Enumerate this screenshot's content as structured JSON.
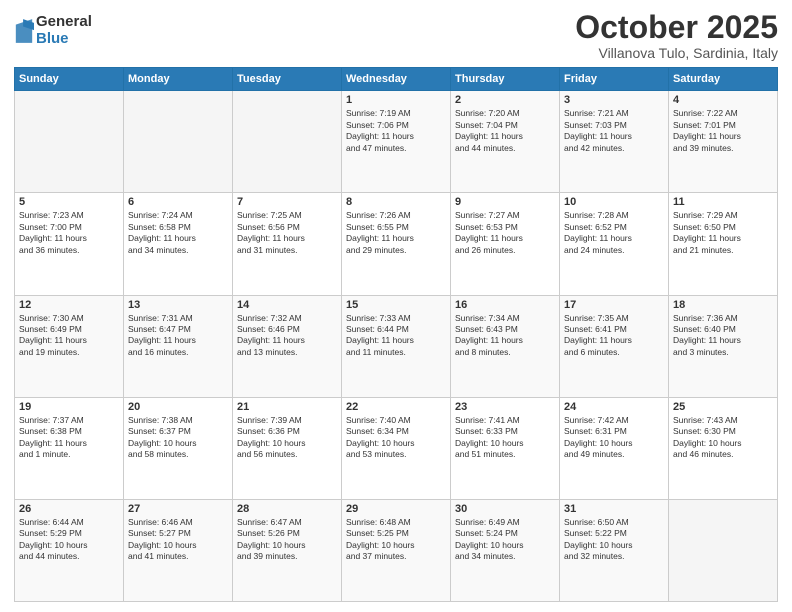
{
  "logo": {
    "general": "General",
    "blue": "Blue"
  },
  "title": "October 2025",
  "subtitle": "Villanova Tulo, Sardinia, Italy",
  "headers": [
    "Sunday",
    "Monday",
    "Tuesday",
    "Wednesday",
    "Thursday",
    "Friday",
    "Saturday"
  ],
  "weeks": [
    [
      {
        "day": "",
        "info": ""
      },
      {
        "day": "",
        "info": ""
      },
      {
        "day": "",
        "info": ""
      },
      {
        "day": "1",
        "info": "Sunrise: 7:19 AM\nSunset: 7:06 PM\nDaylight: 11 hours\nand 47 minutes."
      },
      {
        "day": "2",
        "info": "Sunrise: 7:20 AM\nSunset: 7:04 PM\nDaylight: 11 hours\nand 44 minutes."
      },
      {
        "day": "3",
        "info": "Sunrise: 7:21 AM\nSunset: 7:03 PM\nDaylight: 11 hours\nand 42 minutes."
      },
      {
        "day": "4",
        "info": "Sunrise: 7:22 AM\nSunset: 7:01 PM\nDaylight: 11 hours\nand 39 minutes."
      }
    ],
    [
      {
        "day": "5",
        "info": "Sunrise: 7:23 AM\nSunset: 7:00 PM\nDaylight: 11 hours\nand 36 minutes."
      },
      {
        "day": "6",
        "info": "Sunrise: 7:24 AM\nSunset: 6:58 PM\nDaylight: 11 hours\nand 34 minutes."
      },
      {
        "day": "7",
        "info": "Sunrise: 7:25 AM\nSunset: 6:56 PM\nDaylight: 11 hours\nand 31 minutes."
      },
      {
        "day": "8",
        "info": "Sunrise: 7:26 AM\nSunset: 6:55 PM\nDaylight: 11 hours\nand 29 minutes."
      },
      {
        "day": "9",
        "info": "Sunrise: 7:27 AM\nSunset: 6:53 PM\nDaylight: 11 hours\nand 26 minutes."
      },
      {
        "day": "10",
        "info": "Sunrise: 7:28 AM\nSunset: 6:52 PM\nDaylight: 11 hours\nand 24 minutes."
      },
      {
        "day": "11",
        "info": "Sunrise: 7:29 AM\nSunset: 6:50 PM\nDaylight: 11 hours\nand 21 minutes."
      }
    ],
    [
      {
        "day": "12",
        "info": "Sunrise: 7:30 AM\nSunset: 6:49 PM\nDaylight: 11 hours\nand 19 minutes."
      },
      {
        "day": "13",
        "info": "Sunrise: 7:31 AM\nSunset: 6:47 PM\nDaylight: 11 hours\nand 16 minutes."
      },
      {
        "day": "14",
        "info": "Sunrise: 7:32 AM\nSunset: 6:46 PM\nDaylight: 11 hours\nand 13 minutes."
      },
      {
        "day": "15",
        "info": "Sunrise: 7:33 AM\nSunset: 6:44 PM\nDaylight: 11 hours\nand 11 minutes."
      },
      {
        "day": "16",
        "info": "Sunrise: 7:34 AM\nSunset: 6:43 PM\nDaylight: 11 hours\nand 8 minutes."
      },
      {
        "day": "17",
        "info": "Sunrise: 7:35 AM\nSunset: 6:41 PM\nDaylight: 11 hours\nand 6 minutes."
      },
      {
        "day": "18",
        "info": "Sunrise: 7:36 AM\nSunset: 6:40 PM\nDaylight: 11 hours\nand 3 minutes."
      }
    ],
    [
      {
        "day": "19",
        "info": "Sunrise: 7:37 AM\nSunset: 6:38 PM\nDaylight: 11 hours\nand 1 minute."
      },
      {
        "day": "20",
        "info": "Sunrise: 7:38 AM\nSunset: 6:37 PM\nDaylight: 10 hours\nand 58 minutes."
      },
      {
        "day": "21",
        "info": "Sunrise: 7:39 AM\nSunset: 6:36 PM\nDaylight: 10 hours\nand 56 minutes."
      },
      {
        "day": "22",
        "info": "Sunrise: 7:40 AM\nSunset: 6:34 PM\nDaylight: 10 hours\nand 53 minutes."
      },
      {
        "day": "23",
        "info": "Sunrise: 7:41 AM\nSunset: 6:33 PM\nDaylight: 10 hours\nand 51 minutes."
      },
      {
        "day": "24",
        "info": "Sunrise: 7:42 AM\nSunset: 6:31 PM\nDaylight: 10 hours\nand 49 minutes."
      },
      {
        "day": "25",
        "info": "Sunrise: 7:43 AM\nSunset: 6:30 PM\nDaylight: 10 hours\nand 46 minutes."
      }
    ],
    [
      {
        "day": "26",
        "info": "Sunrise: 6:44 AM\nSunset: 5:29 PM\nDaylight: 10 hours\nand 44 minutes."
      },
      {
        "day": "27",
        "info": "Sunrise: 6:46 AM\nSunset: 5:27 PM\nDaylight: 10 hours\nand 41 minutes."
      },
      {
        "day": "28",
        "info": "Sunrise: 6:47 AM\nSunset: 5:26 PM\nDaylight: 10 hours\nand 39 minutes."
      },
      {
        "day": "29",
        "info": "Sunrise: 6:48 AM\nSunset: 5:25 PM\nDaylight: 10 hours\nand 37 minutes."
      },
      {
        "day": "30",
        "info": "Sunrise: 6:49 AM\nSunset: 5:24 PM\nDaylight: 10 hours\nand 34 minutes."
      },
      {
        "day": "31",
        "info": "Sunrise: 6:50 AM\nSunset: 5:22 PM\nDaylight: 10 hours\nand 32 minutes."
      },
      {
        "day": "",
        "info": ""
      }
    ]
  ]
}
